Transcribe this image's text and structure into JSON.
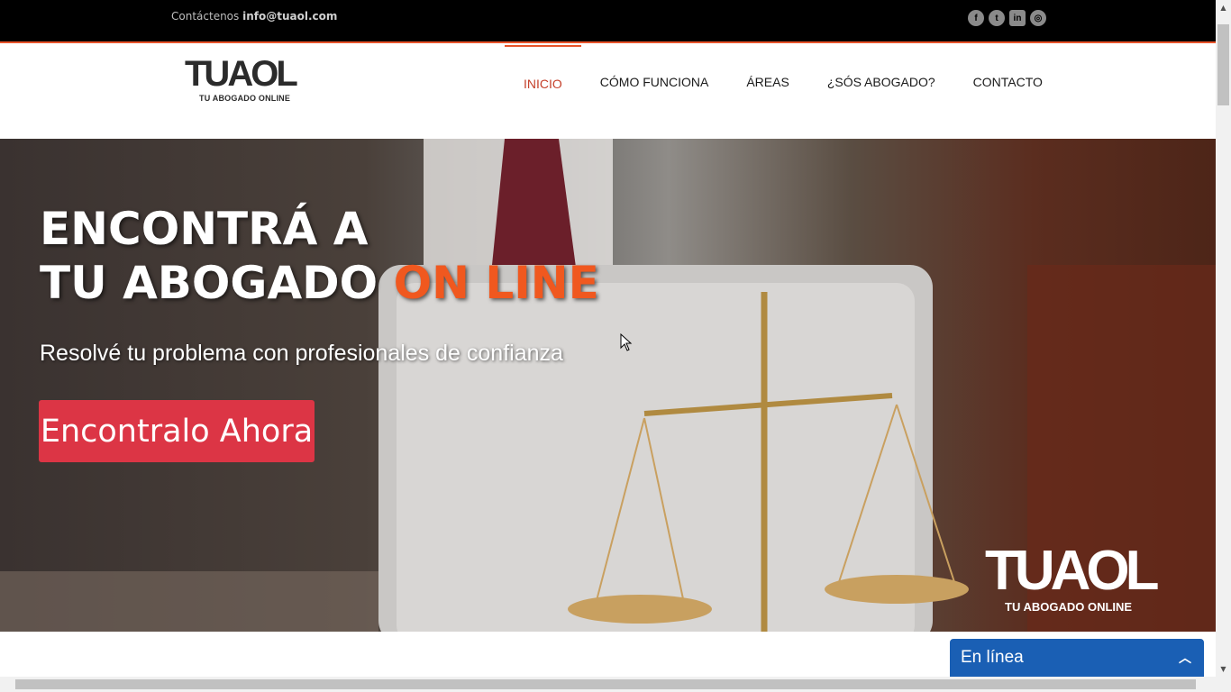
{
  "topbar": {
    "contact_label": "Contáctenos",
    "email": "info@tuaol.com"
  },
  "social": [
    {
      "icon": "facebook-icon",
      "glyph": "f"
    },
    {
      "icon": "twitter-icon",
      "glyph": "t"
    },
    {
      "icon": "linkedin-icon",
      "glyph": "in"
    },
    {
      "icon": "instagram-icon",
      "glyph": "◎"
    }
  ],
  "logo": {
    "text": "TUAOL",
    "subtitle": "TU ABOGADO ONLINE"
  },
  "nav": [
    {
      "label": "INICIO",
      "active": true
    },
    {
      "label": "CÓMO FUNCIONA",
      "active": false
    },
    {
      "label": "ÁREAS",
      "active": false
    },
    {
      "label": "¿SÓS ABOGADO?",
      "active": false
    },
    {
      "label": "CONTACTO",
      "active": false
    }
  ],
  "hero": {
    "title_line1": "ENCONTRÁ A",
    "title_line2": "TU ABOGADO ",
    "title_accent": "ON LINE",
    "subtitle": "Resolvé tu problema con profesionales de confianza",
    "cta": "Encontralo Ahora",
    "watermark_text": "TUAOL",
    "watermark_sub": "TU ABOGADO ONLINE"
  },
  "chat": {
    "label": "En línea"
  },
  "colors": {
    "accent": "#f0581f",
    "cta": "#dc3545",
    "chat": "#1a5fb4"
  }
}
